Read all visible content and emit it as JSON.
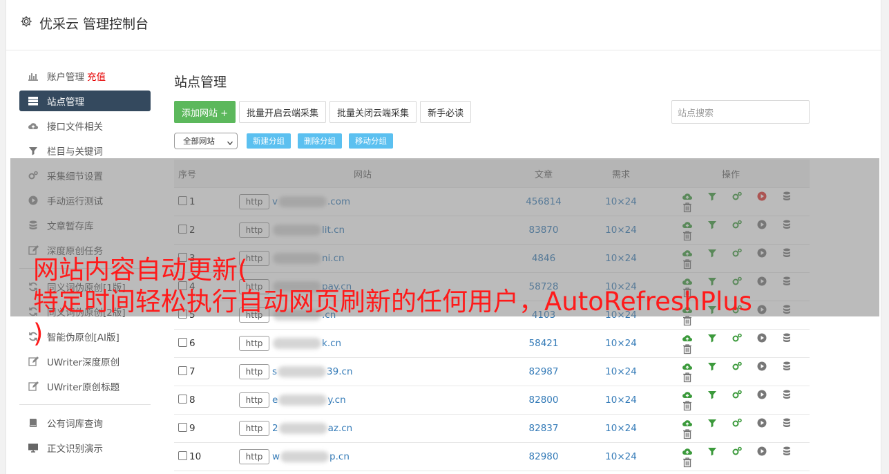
{
  "header": {
    "title": "优采云 管理控制台"
  },
  "sidebar": {
    "items": [
      {
        "label": "账户管理",
        "badge": "充值",
        "icon": "bar-chart-icon"
      },
      {
        "label": "站点管理",
        "icon": "server-icon",
        "active": true
      },
      {
        "label": "接口文件相关",
        "icon": "cloud-upload-icon"
      },
      {
        "label": "栏目与关键词",
        "icon": "filter-icon"
      },
      {
        "label": "采集细节设置",
        "icon": "gears-icon"
      },
      {
        "label": "手动运行测试",
        "icon": "play-circle-icon"
      },
      {
        "label": "文章暂存库",
        "icon": "database-icon"
      },
      {
        "label": "深度原创任务",
        "icon": "edit-icon"
      },
      {
        "label": "同义词伪原创[1版]",
        "icon": "refresh-icon"
      },
      {
        "label": "同义词伪原创[2版]",
        "icon": "refresh-icon"
      },
      {
        "label": "智能伪原创[AI版]",
        "icon": "refresh-icon"
      },
      {
        "label": "UWriter深度原创",
        "icon": "edit-icon"
      },
      {
        "label": "UWriter原创标题",
        "icon": "edit-icon"
      },
      {
        "label": "公有词库查询",
        "icon": "book-icon"
      },
      {
        "label": "正文识别演示",
        "icon": "monitor-icon"
      }
    ]
  },
  "main": {
    "title": "站点管理",
    "toolbar": {
      "add_site": "添加网站 +",
      "batch_open": "批量开启云端采集",
      "batch_close": "批量关闭云端采集",
      "guide": "新手必读",
      "search_placeholder": "站点搜索"
    },
    "group_bar": {
      "select_value": "全部网站",
      "new_group": "新建分组",
      "delete_group": "删除分组",
      "move_group": "移动分组"
    },
    "table": {
      "headers": {
        "no": "序号",
        "site": "网站",
        "articles": "文章",
        "demand": "需求",
        "ops": "操作"
      },
      "rows": [
        {
          "no": "1",
          "protocol": "http",
          "prefix": "v",
          "suffix": ".com",
          "articles": "456814",
          "demand": "10×24",
          "running": true
        },
        {
          "no": "2",
          "protocol": "http",
          "prefix": "",
          "suffix": "lit.cn",
          "articles": "83870",
          "demand": "10×24",
          "running": false
        },
        {
          "no": "3",
          "protocol": "http",
          "prefix": "",
          "suffix": "ni.cn",
          "articles": "4846",
          "demand": "10×24",
          "running": false
        },
        {
          "no": "4",
          "protocol": "http",
          "prefix": "",
          "suffix": "pay.cn",
          "articles": "58728",
          "demand": "10×24",
          "running": false
        },
        {
          "no": "5",
          "protocol": "http",
          "prefix": "",
          "suffix": ".cn",
          "articles": "4103",
          "demand": "10×24",
          "running": false
        },
        {
          "no": "6",
          "protocol": "http",
          "prefix": "",
          "suffix": "k.cn",
          "articles": "58421",
          "demand": "10×24",
          "running": false
        },
        {
          "no": "7",
          "protocol": "http",
          "prefix": "s",
          "suffix": "39.cn",
          "articles": "82987",
          "demand": "10×24",
          "running": false
        },
        {
          "no": "8",
          "protocol": "http",
          "prefix": "e",
          "suffix": "y.cn",
          "articles": "82800",
          "demand": "10×24",
          "running": false
        },
        {
          "no": "9",
          "protocol": "http",
          "prefix": "2",
          "suffix": "az.cn",
          "articles": "82837",
          "demand": "10×24",
          "running": false
        },
        {
          "no": "10",
          "protocol": "http",
          "prefix": "w",
          "suffix": "p.cn",
          "articles": "82980",
          "demand": "10×24",
          "running": false
        }
      ]
    }
  },
  "overlay": {
    "line1": "网站内容自动更新(",
    "line2": "特定时间轻松执行自动网页刷新的任何用户，AutoRefreshPlus",
    "line3": ")"
  },
  "colors": {
    "sidebar_active": "#34495e",
    "primary_green": "#5cb85c",
    "small_btn": "#5bc0f0",
    "link": "#337ab7",
    "overlay_text": "#ff1a1a",
    "badge": "#e60000"
  }
}
